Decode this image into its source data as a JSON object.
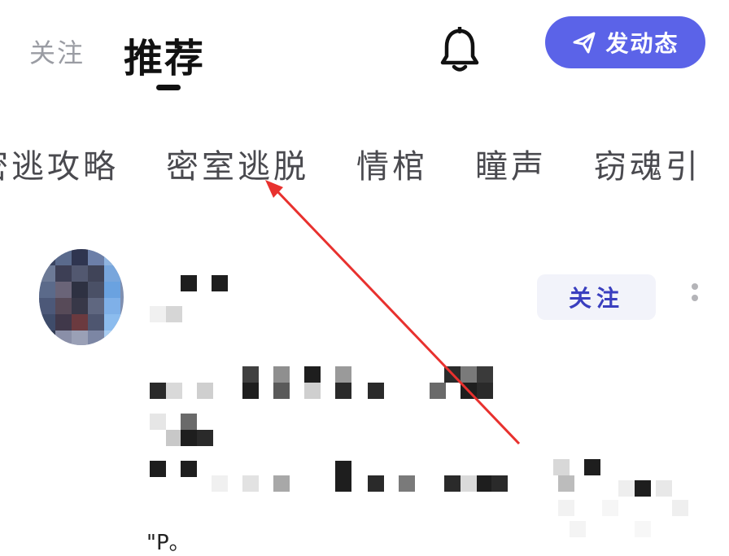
{
  "header": {
    "tab_follow": "关注",
    "tab_recommend": "推荐",
    "post_button_label": "发动态"
  },
  "categories": [
    {
      "label": "密逃攻略"
    },
    {
      "label": "密室逃脱"
    },
    {
      "label": "情棺"
    },
    {
      "label": "瞳声"
    },
    {
      "label": "窃魂引"
    }
  ],
  "post": {
    "follow_label": "关注",
    "tail_text": "\"P。"
  },
  "colors": {
    "accent": "#5b63e8",
    "annotation_arrow": "#e8312e"
  },
  "icons": {
    "bell": "bell-icon",
    "send": "send-icon",
    "more": "more-vertical-icon"
  }
}
